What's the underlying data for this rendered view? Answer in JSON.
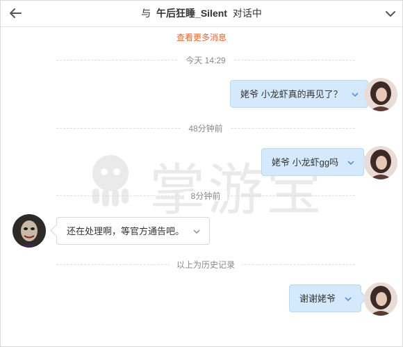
{
  "header": {
    "prefix": "与",
    "name": "午后狂睡_Silent",
    "suffix": "对话中"
  },
  "more_link": "查看更多消息",
  "watermark": {
    "text": "掌游宝"
  },
  "dividers": [
    "今天 14:29",
    "48分钟前",
    "8分钟前",
    "以上为历史记录"
  ],
  "messages": [
    {
      "side": "me",
      "text": "姥爷 小龙虾真的再见了？"
    },
    {
      "side": "me",
      "text": "姥爷 小龙虾gg吗"
    },
    {
      "side": "other",
      "text": "还在处理啊，等官方通告吧。"
    },
    {
      "side": "me",
      "text": "谢谢姥爷"
    }
  ],
  "colors": {
    "accent": "#e8652e",
    "my_bubble": "#d4e9fb",
    "chevron": "#5a8fd0"
  }
}
